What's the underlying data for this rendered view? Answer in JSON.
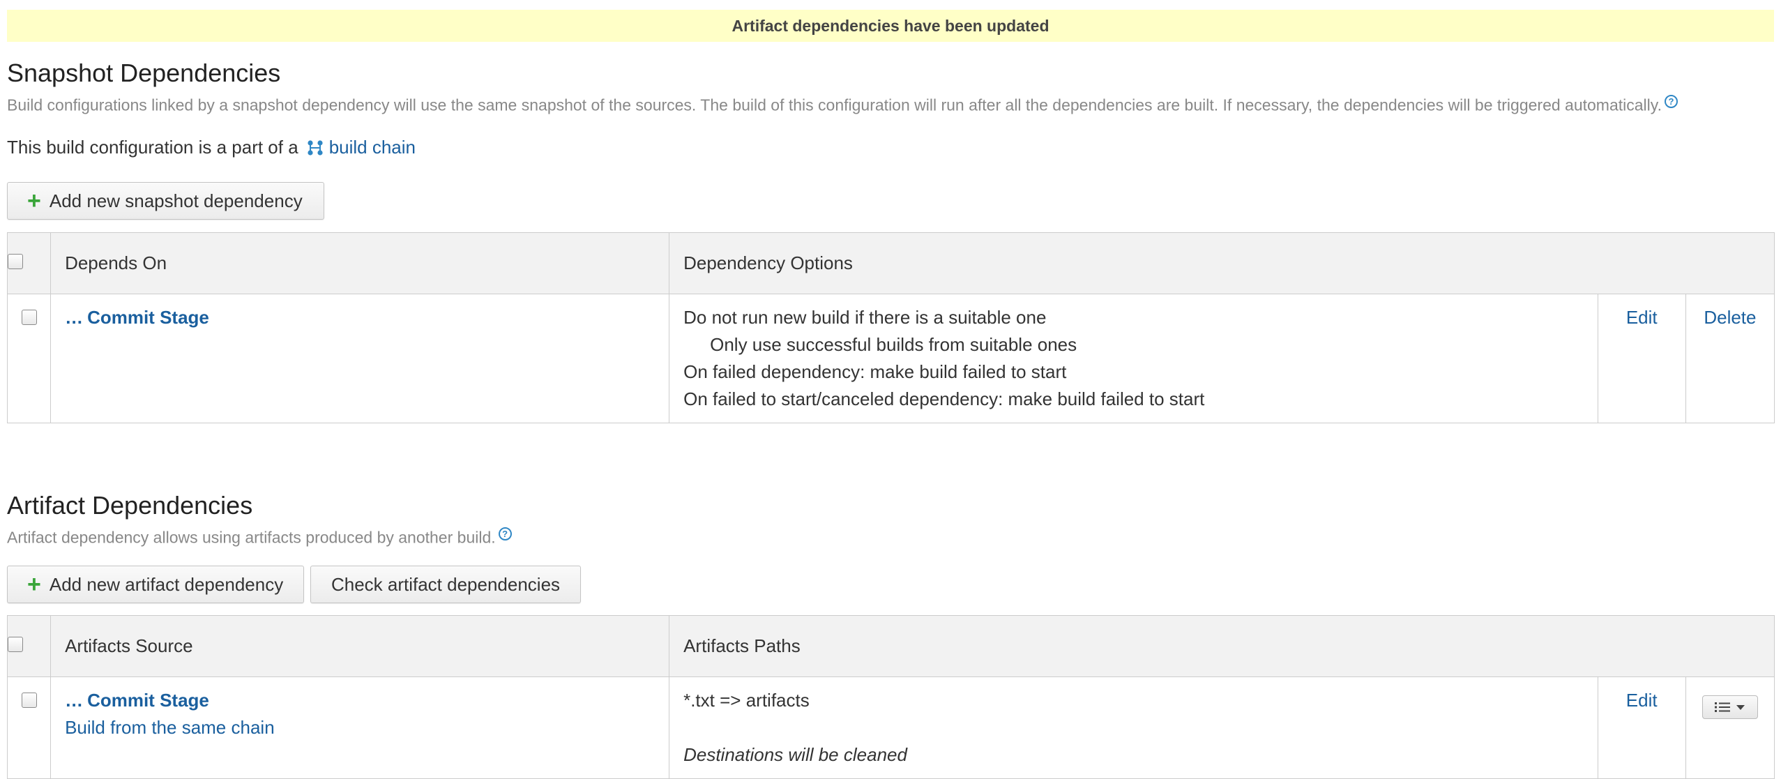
{
  "banner": {
    "message": "Artifact dependencies have been updated"
  },
  "snapshot": {
    "title": "Snapshot Dependencies",
    "description": "Build configurations linked by a snapshot dependency will use the same snapshot of the sources. The build of this configuration will run after all the dependencies are built. If necessary, the dependencies will be triggered automatically.",
    "chain_prefix": "This build configuration is a part of a",
    "chain_link": "build chain",
    "add_button": "Add new snapshot dependency",
    "columns": {
      "depends_on": "Depends On",
      "options": "Dependency Options"
    },
    "rows": [
      {
        "ellipsis": "…",
        "name": "Commit Stage",
        "options": [
          "Do not run new build if there is a suitable one",
          "Only use successful builds from suitable ones",
          "On failed dependency: make build failed to start",
          "On failed to start/canceled dependency: make build failed to start"
        ],
        "edit": "Edit",
        "delete": "Delete"
      }
    ]
  },
  "artifact": {
    "title": "Artifact Dependencies",
    "description": "Artifact dependency allows using artifacts produced by another build.",
    "add_button": "Add new artifact dependency",
    "check_button": "Check artifact dependencies",
    "columns": {
      "source": "Artifacts Source",
      "paths": "Artifacts Paths"
    },
    "rows": [
      {
        "ellipsis": "…",
        "name": "Commit Stage",
        "source_rule": "Build from the same chain",
        "path": "*.txt => artifacts",
        "note": "Destinations will be cleaned",
        "edit": "Edit"
      }
    ]
  },
  "icons": {
    "help": "help-circle-icon",
    "chain": "build-chain-icon",
    "plus": "plus-icon",
    "menu": "list-menu-icon"
  },
  "colors": {
    "link": "#1a5f9e",
    "banner_bg": "#ffffc7",
    "plus": "#3aa53a"
  }
}
